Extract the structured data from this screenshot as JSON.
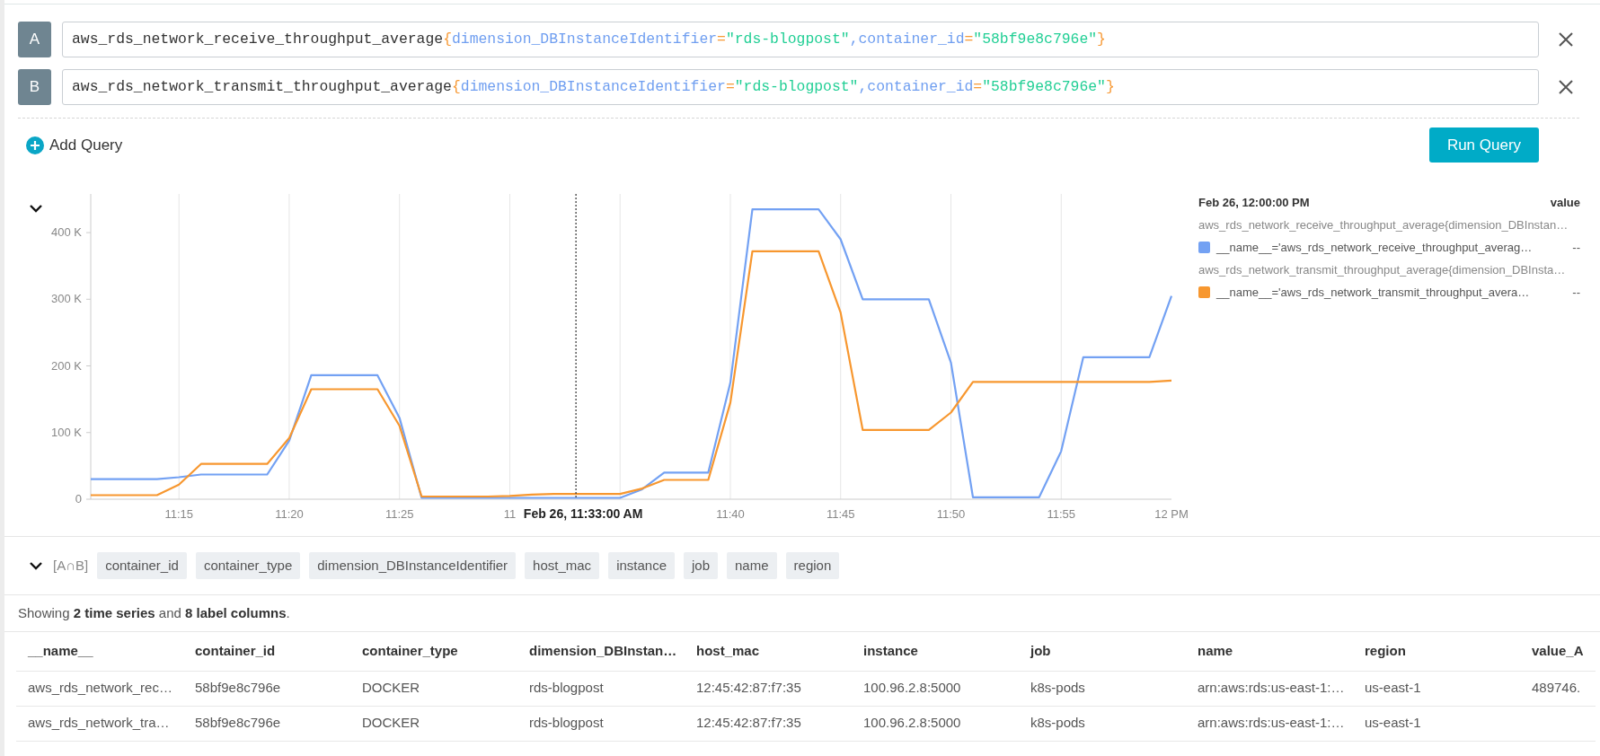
{
  "queries": [
    {
      "letter": "A",
      "tokens": [
        {
          "kind": "metric",
          "text": "aws_rds_network_receive_throughput_average"
        },
        {
          "kind": "brace",
          "text": "{"
        },
        {
          "kind": "label",
          "text": "dimension_DBInstanceIdentifier"
        },
        {
          "kind": "operator",
          "text": "="
        },
        {
          "kind": "string",
          "text": "\"rds-blogpost\""
        },
        {
          "kind": "punct",
          "text": ","
        },
        {
          "kind": "label",
          "text": "container_id"
        },
        {
          "kind": "operator",
          "text": "="
        },
        {
          "kind": "string",
          "text": "\"58bf9e8c796e\""
        },
        {
          "kind": "brace",
          "text": "}"
        }
      ]
    },
    {
      "letter": "B",
      "tokens": [
        {
          "kind": "metric",
          "text": "aws_rds_network_transmit_throughput_average"
        },
        {
          "kind": "brace",
          "text": "{"
        },
        {
          "kind": "label",
          "text": "dimension_DBInstanceIdentifier"
        },
        {
          "kind": "operator",
          "text": "="
        },
        {
          "kind": "string",
          "text": "\"rds-blogpost\""
        },
        {
          "kind": "punct",
          "text": ","
        },
        {
          "kind": "label",
          "text": "container_id"
        },
        {
          "kind": "operator",
          "text": "="
        },
        {
          "kind": "string",
          "text": "\"58bf9e8c796e\""
        },
        {
          "kind": "brace",
          "text": "}"
        }
      ]
    }
  ],
  "add_query": "Add Query",
  "run_query": "Run Query",
  "chart": {
    "expanded": true,
    "chart_data": {
      "type": "line",
      "categories": [
        null,
        null,
        null,
        null,
        "11:15",
        null,
        null,
        null,
        null,
        "11:20",
        null,
        null,
        null,
        null,
        "11:25",
        null,
        null,
        null,
        null,
        "11",
        null,
        null,
        null,
        null,
        null,
        null,
        null,
        null,
        null,
        "11:40",
        null,
        null,
        null,
        null,
        "11:45",
        null,
        null,
        null,
        null,
        "11:50",
        null,
        null,
        null,
        null,
        "11:55",
        null,
        null,
        null,
        null,
        "12 PM"
      ],
      "ylim": [
        0,
        458
      ],
      "grid": true,
      "yticks": [
        {
          "value": 0,
          "label": "0"
        },
        {
          "value": 100,
          "label": "100 K"
        },
        {
          "value": 200,
          "label": "200 K"
        },
        {
          "value": 300,
          "label": "300 K"
        },
        {
          "value": 400,
          "label": "400 K"
        }
      ],
      "series": [
        {
          "name": "__name__='aws_rds_network_receive_throughput_averag…",
          "color": "#73a1f3",
          "values": [
            30,
            30,
            30,
            30,
            33,
            37,
            37,
            37,
            37,
            88,
            186,
            186,
            186,
            186,
            122,
            2,
            2,
            2,
            2,
            2,
            2,
            2,
            2,
            2,
            2,
            15,
            40,
            40,
            40,
            175,
            435,
            435,
            435,
            435,
            390,
            300,
            300,
            300,
            300,
            205,
            3,
            3,
            3,
            3,
            72,
            213,
            213,
            213,
            213,
            305
          ]
        },
        {
          "name": "__name__='aws_rds_network_transmit_throughput_avera…",
          "color": "#f7972f",
          "values": [
            6,
            6,
            6,
            6,
            22,
            53,
            53,
            53,
            53,
            92,
            165,
            165,
            165,
            165,
            110,
            4,
            4,
            4,
            4,
            5,
            7,
            8,
            8,
            8,
            8,
            16,
            29,
            29,
            29,
            145,
            372,
            372,
            372,
            372,
            280,
            104,
            104,
            104,
            104,
            130,
            176,
            176,
            176,
            176,
            176,
            176,
            176,
            176,
            176,
            178
          ]
        }
      ],
      "annotations": [
        {
          "text": "Feb 26, 11:33:00 AM"
        }
      ]
    },
    "legend": {
      "time": "Feb 26, 12:00:00 PM",
      "heading": "value",
      "groups": [
        {
          "query": "aws_rds_network_receive_throughput_average{dimension_DBInstan…",
          "value": "--"
        },
        {
          "query": "aws_rds_network_transmit_throughput_average{dimension_DBInsta…",
          "value": "--"
        }
      ]
    }
  },
  "labels": {
    "expanded": true,
    "set": "[A∩B]",
    "chips": [
      "container_id",
      "container_type",
      "dimension_DBInstanceIdentifier",
      "host_mac",
      "instance",
      "job",
      "name",
      "region"
    ]
  },
  "summary": "Showing **2 time series** and **8 label columns**.",
  "table": {
    "columns": [
      "__name__",
      "container_id",
      "container_type",
      "dimension_DBInstan…",
      "host_mac",
      "instance",
      "job",
      "name",
      "region",
      "value_A"
    ],
    "rows": [
      [
        "aws_rds_network_rec…",
        "58bf9e8c796e",
        "DOCKER",
        "rds-blogpost",
        "12:45:42:87:f7:35",
        "100.96.2.8:5000",
        "k8s-pods",
        "arn:aws:rds:us-east-1:…",
        "us-east-1",
        "489746."
      ],
      [
        "aws_rds_network_tra…",
        "58bf9e8c796e",
        "DOCKER",
        "rds-blogpost",
        "12:45:42:87:f7:35",
        "100.96.2.8:5000",
        "k8s-pods",
        "arn:aws:rds:us-east-1:…",
        "us-east-1"
      ]
    ]
  }
}
